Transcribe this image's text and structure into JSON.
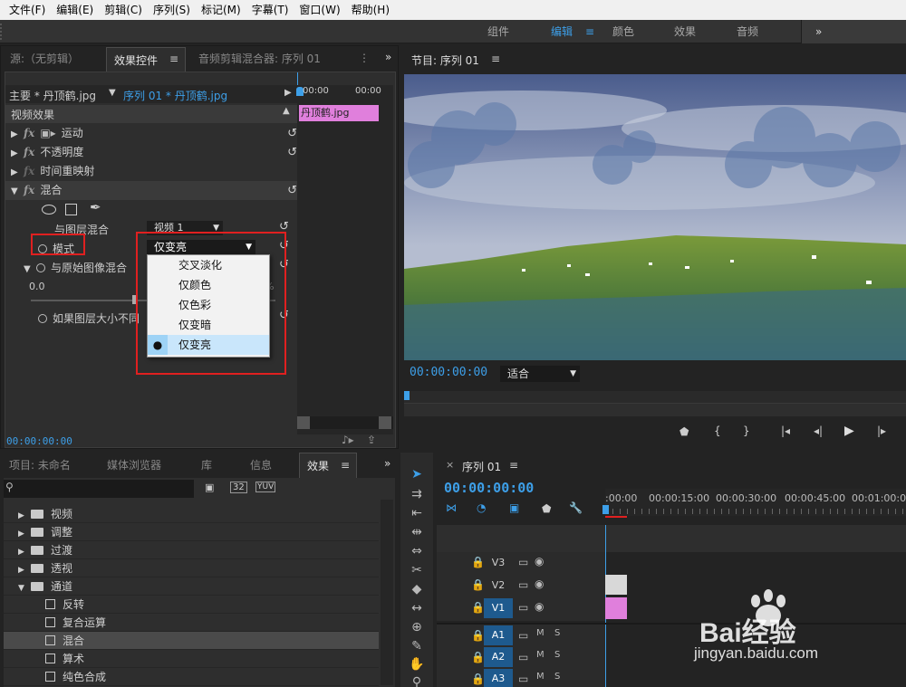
{
  "menu": [
    "文件(F)",
    "编辑(E)",
    "剪辑(C)",
    "序列(S)",
    "标记(M)",
    "字幕(T)",
    "窗口(W)",
    "帮助(H)"
  ],
  "workspaces": {
    "items": [
      "组件",
      "编辑",
      "颜色",
      "效果",
      "音频"
    ],
    "active": "编辑",
    "more": "»"
  },
  "source_panel": {
    "tabs": [
      "源:（无剪辑）",
      "效果控件",
      "音频剪辑混合器: 序列 01"
    ],
    "active_tab": "效果控件",
    "master_label": "主要 * 丹顶鹤.jpg",
    "sequence_label": "序列 01 * 丹顶鹤.jpg",
    "time_start": "00:00",
    "time_end": "00:00",
    "clip_name": "丹顶鹤.jpg",
    "section": "视频效果",
    "effects": [
      "运动",
      "不透明度",
      "时间重映射",
      "混合"
    ],
    "blend": {
      "layer_label": "与图层混合",
      "layer_value": "视频 1",
      "mode_label": "模式",
      "mode_value": "仅变亮",
      "orig_label": "与原始图像混合",
      "orig_value": "0.0",
      "scale_label": "如果图层大小不同"
    },
    "dropdown_options": [
      "交叉淡化",
      "仅颜色",
      "仅色彩",
      "仅变暗",
      "仅变亮"
    ],
    "dropdown_selected": "仅变亮",
    "timecode": "00:00:00:00"
  },
  "program_panel": {
    "title": "节目: 序列 01",
    "timecode": "00:00:00:00",
    "fit": "适合"
  },
  "project_panel": {
    "tabs": [
      "项目: 未命名",
      "媒体浏览器",
      "库",
      "信息",
      "效果"
    ],
    "active_tab": "效果",
    "filter_icons": [
      "32",
      "YUV"
    ],
    "tree": [
      {
        "label": "视频",
        "type": "folder",
        "open": false
      },
      {
        "label": "调整",
        "type": "folder",
        "open": false
      },
      {
        "label": "过渡",
        "type": "folder",
        "open": false
      },
      {
        "label": "透视",
        "type": "folder",
        "open": false
      },
      {
        "label": "通道",
        "type": "folder",
        "open": true
      },
      {
        "label": "反转",
        "type": "item"
      },
      {
        "label": "复合运算",
        "type": "item"
      },
      {
        "label": "混合",
        "type": "item",
        "selected": true
      },
      {
        "label": "算术",
        "type": "item"
      },
      {
        "label": "纯色合成",
        "type": "item"
      }
    ]
  },
  "timeline": {
    "title": "序列 01",
    "timecode": "00:00:00:00",
    "ruler": [
      ":00:00",
      "00:00:15:00",
      "00:00:30:00",
      "00:00:45:00",
      "00:01:00:00"
    ],
    "video_tracks": [
      "V3",
      "V2",
      "V1"
    ],
    "audio_tracks": [
      "A1",
      "A2",
      "A3"
    ],
    "m": "M",
    "s": "S"
  },
  "watermark": {
    "brand": "Bai经验",
    "url": "jingyan.baidu.com"
  },
  "colors": {
    "accent": "#3d9fe8",
    "clip_pink": "#e07fdc",
    "highlight_red": "#e02020"
  }
}
